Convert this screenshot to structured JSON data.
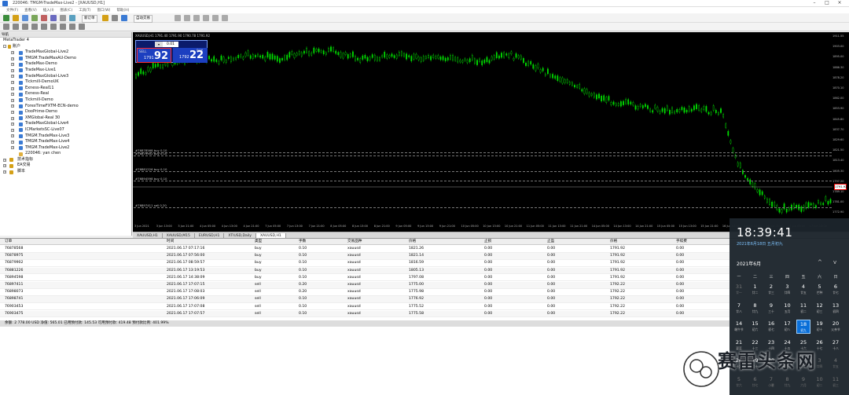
{
  "window": {
    "title": "220046: TMGM-TradeMax-Live2 - [XAUUSD,H1]"
  },
  "menu": [
    "文件(F)",
    "查看(V)",
    "插入(I)",
    "图表(C)",
    "工具(T)",
    "窗口(W)",
    "帮助(H)"
  ],
  "toolbar": {
    "new_order": "新订单",
    "auto_trading": "自动交易"
  },
  "navigator": {
    "header": "导航",
    "root": "MetaTrader 4",
    "accounts_label": "账户",
    "accounts": [
      "TradeMaxGlobal-Live2",
      "TMGM.TradeMaxAU-Demo",
      "TradeMax-Demo",
      "TradeMax-Live1",
      "TradeMaxGlobal-Live3",
      "TickmilI-DemoUK",
      "Exness-Real11",
      "Exness-Real",
      "TickmilI-Demo",
      "ForexTimeFXTM-ECN-demo",
      "DooPrime-Demo",
      "XMGlobal-Real 30",
      "TradeMaxGlobal-Live4",
      "ICMarketsSC-Live07",
      "TMGM.TradeMax-Live3",
      "TMGM.TradeMax-Live4",
      "TMGM.TradeMax-Live2"
    ],
    "account_user": "220046: yan chen",
    "sections": [
      "技术指标",
      "EA交易",
      "脚本"
    ],
    "tabs": [
      "常用",
      "收藏夹"
    ]
  },
  "chart": {
    "ohlc": "XAUUSD,H1  1791.40 1791.90 1790.78 1791.92",
    "ticket": {
      "sell_label": "SELL",
      "buy_label": "BUY",
      "lot": "0.01",
      "sell_prefix": "1791",
      "sell_big": "92",
      "buy_prefix": "1792",
      "buy_big": "22"
    },
    "current_price": "1791.92",
    "price_labels": [
      "1911.55",
      "1903.00",
      "1895.00",
      "1886.30",
      "1878.20",
      "1870.10",
      "1862.00",
      "1853.90",
      "1845.80",
      "1837.70",
      "1829.60",
      "1821.50",
      "1813.40",
      "1805.30",
      "1797.20",
      "1789.10",
      "1781.00",
      "1772.90"
    ],
    "time_labels": [
      "3 Jun 2021",
      "3 Jun 13:00",
      "3 Jun 21:00",
      "4 Jun 05:00",
      "4 Jun 13:00",
      "4 Jun 21:00",
      "7 Jun 05:00",
      "7 Jun 13:00",
      "7 Jun 21:00",
      "8 Jun 05:00",
      "8 Jun 13:00",
      "8 Jun 21:00",
      "9 Jun 05:00",
      "9 Jun 13:00",
      "9 Jun 21:00",
      "10 Jun 05:00",
      "10 Jun 13:00",
      "10 Jun 21:00",
      "11 Jun 05:00",
      "11 Jun 13:00",
      "11 Jun 21:00",
      "14 Jun 05:00",
      "14 Jun 13:00",
      "14 Jun 21:00",
      "15 Jun 05:00",
      "15 Jun 13:00",
      "15 Jun 21:00",
      "16 Jun 05:00",
      "16 Jun 13:00",
      "16 Jun 21:00",
      "17 Jun 05:00",
      "17 Jun 13:00"
    ],
    "order_lines": [
      "#76878568 buy 0.10",
      "#76879902 buy 0.10",
      "#76881226 buy 0.10",
      "#76894598 buy 0.10",
      "#76897411 sell 0.20"
    ],
    "tabs": [
      "XAUUSD,H1",
      "XAUUSD,M15",
      "EURUSD,H1",
      "XTIUSD,Daily",
      "XAUUSD,H1"
    ]
  },
  "terminal": {
    "columns": [
      "订单",
      "时间",
      "类型",
      "手数",
      "交易品种",
      "价格",
      "止损",
      "止盈",
      "价格",
      "手续费"
    ],
    "rows": [
      [
        "76878568",
        "2021.06.17 07:17:16",
        "buy",
        "0.10",
        "xauusd",
        "1821.26",
        "0.00",
        "0.00",
        "1791.92",
        "0.00"
      ],
      [
        "76878975",
        "2021.06.17 07:56:00",
        "buy",
        "0.10",
        "xauusd",
        "1821.14",
        "0.00",
        "0.00",
        "1791.92",
        "0.00"
      ],
      [
        "76879902",
        "2021.06.17 08:59:57",
        "buy",
        "0.10",
        "xauusd",
        "1816.59",
        "0.00",
        "0.00",
        "1791.92",
        "0.00"
      ],
      [
        "76881226",
        "2021.06.17 13:19:53",
        "buy",
        "0.10",
        "xauusd",
        "1805.13",
        "0.00",
        "0.00",
        "1791.92",
        "0.00"
      ],
      [
        "76894598",
        "2021.06.17 14:38:09",
        "buy",
        "0.10",
        "xauusd",
        "1797.08",
        "0.00",
        "0.00",
        "1791.92",
        "0.00"
      ],
      [
        "76897411",
        "2021.06.17 17:07:15",
        "sell",
        "0.20",
        "xauusd",
        "1775.00",
        "0.00",
        "0.00",
        "1792.22",
        "0.00"
      ],
      [
        "76898073",
        "2021.06.17 17:08:03",
        "sell",
        "0.20",
        "xauusd",
        "1775.98",
        "0.00",
        "0.00",
        "1792.22",
        "0.00"
      ],
      [
        "76898741",
        "2021.06.17 17:06:09",
        "sell",
        "0.10",
        "xauusd",
        "1776.92",
        "0.00",
        "0.00",
        "1792.22",
        "0.00"
      ],
      [
        "76903453",
        "2021.06.17 17:07:08",
        "sell",
        "0.10",
        "xauusd",
        "1775.52",
        "0.00",
        "0.00",
        "1792.22",
        "0.00"
      ],
      [
        "76903475",
        "2021.06.17 17:07:57",
        "sell",
        "0.10",
        "xauusd",
        "1775.58",
        "0.00",
        "0.00",
        "1792.22",
        "0.00"
      ]
    ],
    "total": "余额: 2 778.00 USD  净值: 565.01  已用预付款: 145.53  可用预付款: 419.48  预付款比例: 401.99%"
  },
  "clock": {
    "time": "18:39:41",
    "date": "2021年6月18日 五月初九",
    "month": "2021年6月",
    "weekdays": [
      "一",
      "二",
      "三",
      "四",
      "五",
      "六",
      "日"
    ],
    "days": [
      {
        "n": "31",
        "l": "廿一",
        "dim": true
      },
      {
        "n": "1",
        "l": "廿二"
      },
      {
        "n": "2",
        "l": "廿三"
      },
      {
        "n": "3",
        "l": "廿四"
      },
      {
        "n": "4",
        "l": "廿五"
      },
      {
        "n": "5",
        "l": "芒种"
      },
      {
        "n": "6",
        "l": "廿七"
      },
      {
        "n": "7",
        "l": "廿八"
      },
      {
        "n": "8",
        "l": "廿九"
      },
      {
        "n": "9",
        "l": "三十"
      },
      {
        "n": "10",
        "l": "五月"
      },
      {
        "n": "11",
        "l": "初二"
      },
      {
        "n": "12",
        "l": "初三"
      },
      {
        "n": "13",
        "l": "初四"
      },
      {
        "n": "14",
        "l": "端午节"
      },
      {
        "n": "15",
        "l": "初六"
      },
      {
        "n": "16",
        "l": "初七"
      },
      {
        "n": "17",
        "l": "初八"
      },
      {
        "n": "18",
        "l": "初九",
        "today": true
      },
      {
        "n": "19",
        "l": "初十"
      },
      {
        "n": "20",
        "l": "父亲节"
      },
      {
        "n": "21",
        "l": "夏至"
      },
      {
        "n": "22",
        "l": "十三"
      },
      {
        "n": "23",
        "l": "十四"
      },
      {
        "n": "24",
        "l": "十五"
      },
      {
        "n": "25",
        "l": "十六"
      },
      {
        "n": "26",
        "l": "十七"
      },
      {
        "n": "27",
        "l": "十八"
      },
      {
        "n": "28",
        "l": "十九"
      },
      {
        "n": "29",
        "l": "二十"
      },
      {
        "n": "30",
        "l": "廿一"
      },
      {
        "n": "1",
        "l": "建党节",
        "dim": true
      },
      {
        "n": "2",
        "l": "廿三",
        "dim": true
      },
      {
        "n": "3",
        "l": "廿四",
        "dim": true
      },
      {
        "n": "4",
        "l": "廿五",
        "dim": true
      },
      {
        "n": "5",
        "l": "廿六",
        "dim": true
      },
      {
        "n": "6",
        "l": "廿七",
        "dim": true
      },
      {
        "n": "7",
        "l": "小暑",
        "dim": true
      },
      {
        "n": "8",
        "l": "廿九",
        "dim": true
      },
      {
        "n": "9",
        "l": "六月",
        "dim": true
      },
      {
        "n": "10",
        "l": "初二",
        "dim": true
      },
      {
        "n": "11",
        "l": "初三",
        "dim": true
      }
    ]
  },
  "watermark": "赛雷头条网",
  "colors": {
    "chart_bg": "#000000",
    "candle": "#00dd00",
    "accent": "#0a6fd8"
  }
}
